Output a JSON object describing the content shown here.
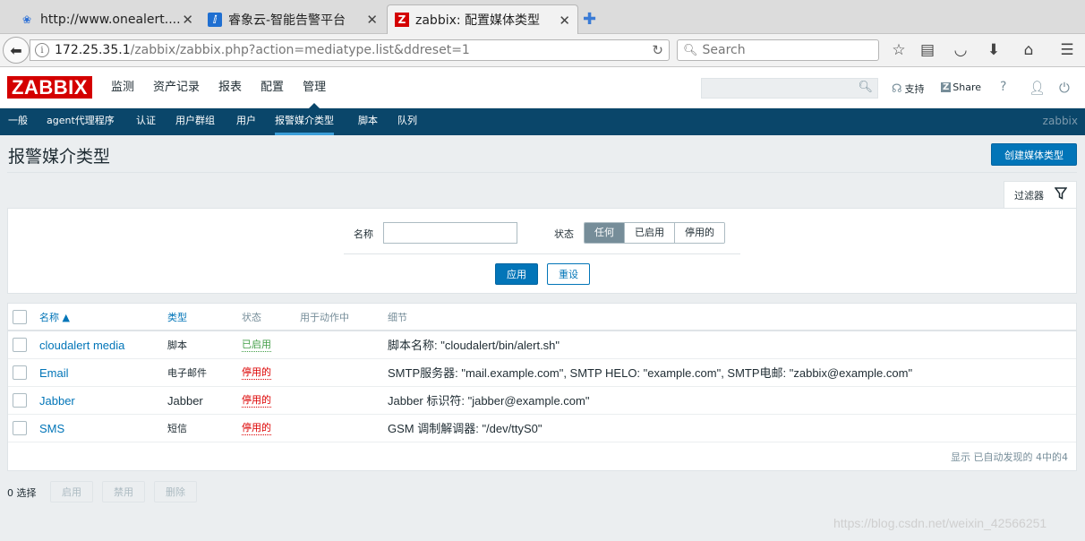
{
  "browser": {
    "tabs": [
      {
        "title": "http://www.onealert....",
        "icon": "paw-icon"
      },
      {
        "title": "睿象云-智能告警平台",
        "icon": "onealert-icon"
      },
      {
        "title": "zabbix: 配置媒体类型",
        "icon": "zabbix-icon",
        "favicon_text": "Z"
      }
    ],
    "url_host": "172.25.35.1",
    "url_path": "/zabbix/zabbix.php?action=mediatype.list&ddreset=1",
    "search_placeholder": "Search"
  },
  "header": {
    "logo": "ZABBIX",
    "menu": [
      "监测",
      "资产记录",
      "报表",
      "配置",
      "管理"
    ],
    "selected_menu": "管理",
    "support": "支持",
    "share": "Share",
    "help": "?"
  },
  "submenu": {
    "items": [
      "一般",
      "agent代理程序",
      "认证",
      "用户群组",
      "用户",
      "报警媒介类型",
      "脚本",
      "队列"
    ],
    "selected": "报警媒介类型",
    "right_label": "zabbix"
  },
  "page": {
    "title": "报警媒介类型",
    "create_button": "创建媒体类型"
  },
  "filter": {
    "tab_label": "过滤器",
    "name_label": "名称",
    "name_value": "",
    "status_label": "状态",
    "status_options": [
      "任何",
      "已启用",
      "停用的"
    ],
    "status_selected": "任何",
    "apply": "应用",
    "reset": "重设"
  },
  "table": {
    "columns": [
      "名称 ▲",
      "类型",
      "状态",
      "用于动作中",
      "细节"
    ],
    "rows": [
      {
        "name": "cloudalert media",
        "type": "脚本",
        "status": "已启用",
        "enabled": true,
        "used_in": "",
        "details": "脚本名称: \"cloudalert/bin/alert.sh\""
      },
      {
        "name": "Email",
        "type": "电子邮件",
        "status": "停用的",
        "enabled": false,
        "used_in": "",
        "details": "SMTP服务器: \"mail.example.com\", SMTP HELO: \"example.com\", SMTP电邮: \"zabbix@example.com\""
      },
      {
        "name": "Jabber",
        "type": "Jabber",
        "status": "停用的",
        "enabled": false,
        "used_in": "",
        "details": "Jabber 标识符: \"jabber@example.com\""
      },
      {
        "name": "SMS",
        "type": "短信",
        "status": "停用的",
        "enabled": false,
        "used_in": "",
        "details": "GSM 调制解调器: \"/dev/ttyS0\""
      }
    ],
    "footer": "显示 已自动发现的 4中的4"
  },
  "actions": {
    "selected_count": "0 选择",
    "enable": "启用",
    "disable": "禁用",
    "delete": "删除"
  },
  "watermark": "https://blog.csdn.net/weixin_42566251",
  "colors": {
    "brand_red": "#d40000",
    "nav_blue": "#0a466a",
    "accent_blue": "#0275b8",
    "enabled_green": "#429e47",
    "disabled_red": "#dc0000"
  }
}
